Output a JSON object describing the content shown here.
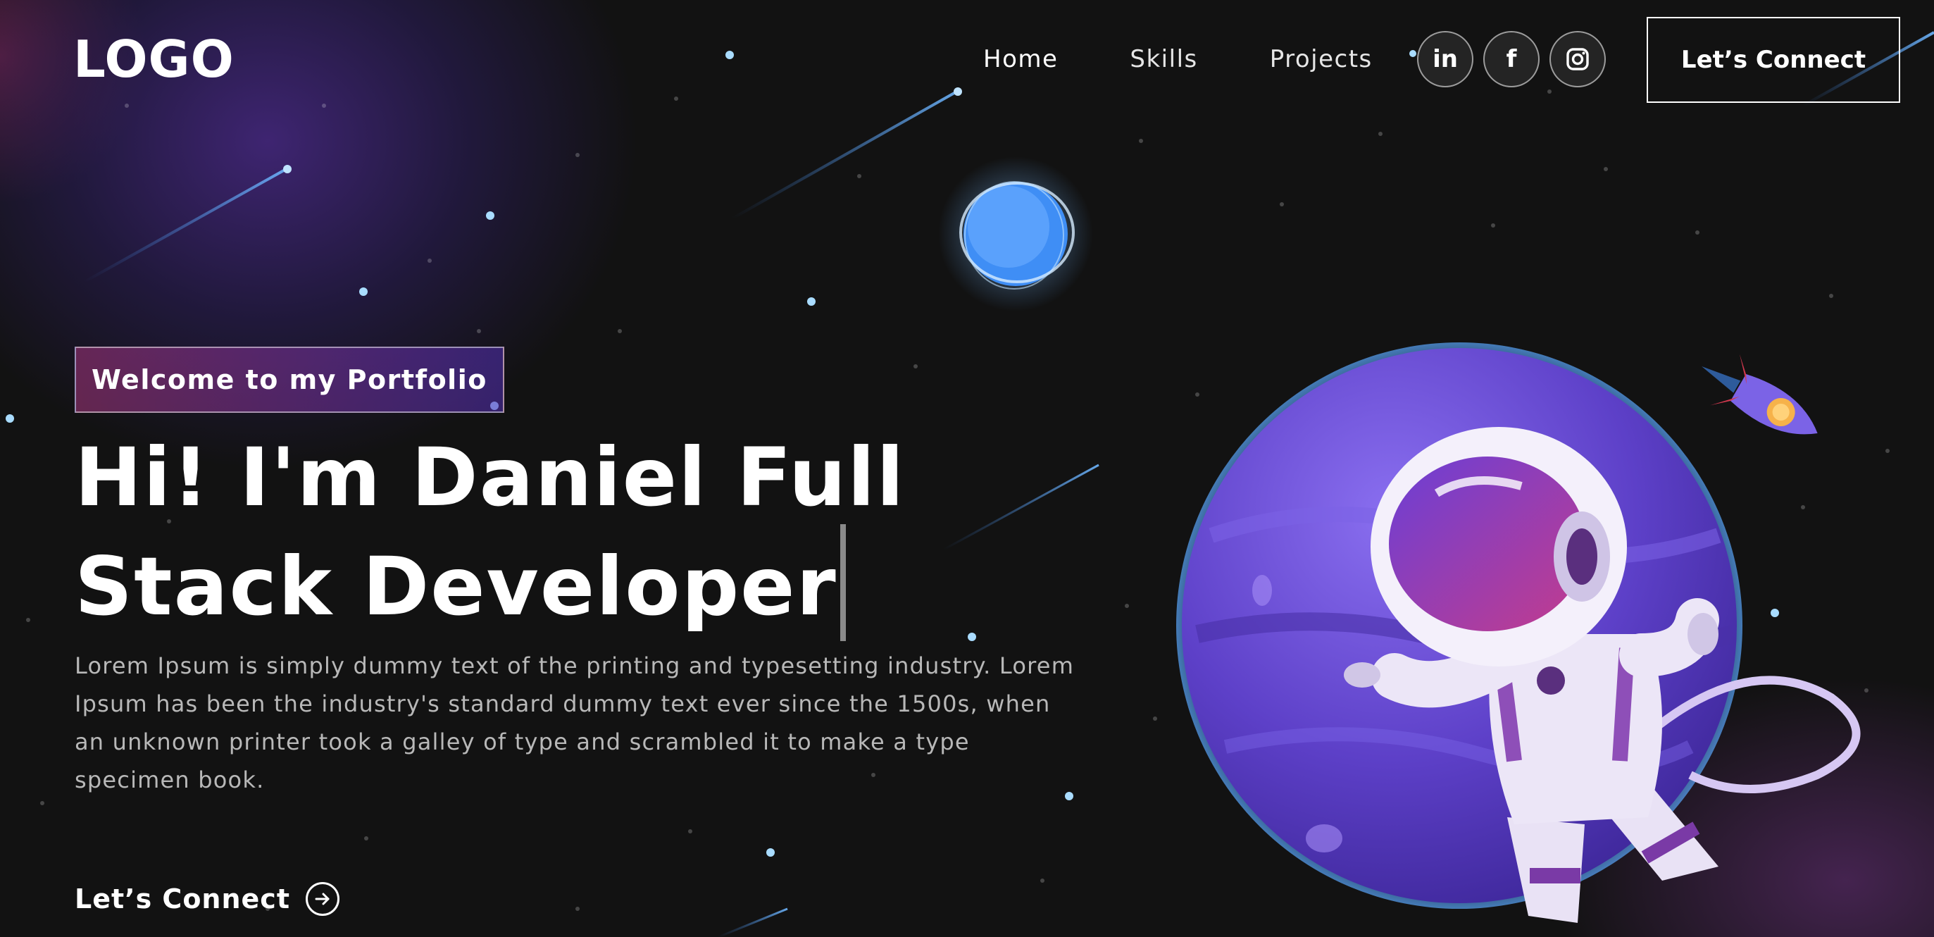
{
  "brand": {
    "logo_text": "LOGO"
  },
  "nav": {
    "links": [
      {
        "label": "Home"
      },
      {
        "label": "Skills"
      },
      {
        "label": "Projects"
      }
    ],
    "socials": [
      {
        "icon": "linkedin-icon",
        "glyph": "in"
      },
      {
        "icon": "facebook-icon",
        "glyph": "f"
      },
      {
        "icon": "instagram-icon",
        "glyph": ""
      }
    ],
    "connect_label": "Let’s Connect"
  },
  "hero": {
    "tagline": "Welcome to my Portfolio",
    "headline": "Hi! I'm Daniel Full Stack Developer",
    "description": "Lorem Ipsum is simply dummy text of the printing and typesetting industry. Lorem Ipsum has been the industry's standard dummy text ever since the 1500s, when an unknown printer took a galley of type and scrambled it to make a type specimen book.",
    "connect_label": "Let’s Connect"
  },
  "colors": {
    "background": "#121212",
    "accent_pink": "#aa367c",
    "accent_purple": "#4a2fbd",
    "text_muted": "#b8b8b8"
  }
}
